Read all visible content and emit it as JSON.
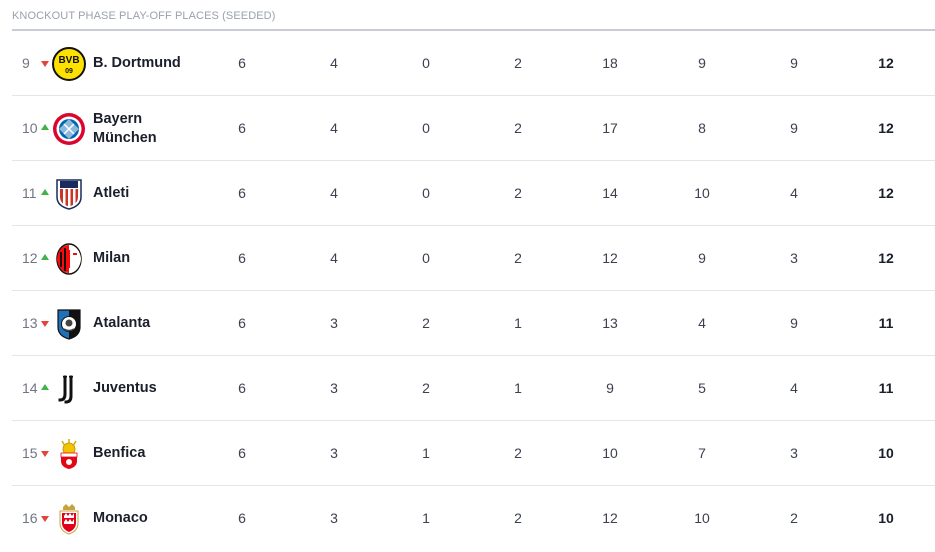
{
  "section": {
    "title": "KNOCKOUT PHASE PLAY-OFF PLACES (SEEDED)"
  },
  "colors": {
    "trend_up": "#3fb24a",
    "trend_down": "#e2443c",
    "divider": "#e3e5ea"
  },
  "rows": [
    {
      "position": "9",
      "trend": "down",
      "logo_icon": "dortmund-crest-icon",
      "team": "B. Dortmund",
      "played": "6",
      "won": "4",
      "drawn": "0",
      "lost": "2",
      "gf": "18",
      "ga": "9",
      "gd": "9",
      "points": "12"
    },
    {
      "position": "10",
      "trend": "up",
      "logo_icon": "bayern-crest-icon",
      "team": "Bayern München",
      "played": "6",
      "won": "4",
      "drawn": "0",
      "lost": "2",
      "gf": "17",
      "ga": "8",
      "gd": "9",
      "points": "12"
    },
    {
      "position": "11",
      "trend": "up",
      "logo_icon": "atleti-crest-icon",
      "team": "Atleti",
      "played": "6",
      "won": "4",
      "drawn": "0",
      "lost": "2",
      "gf": "14",
      "ga": "10",
      "gd": "4",
      "points": "12"
    },
    {
      "position": "12",
      "trend": "up",
      "logo_icon": "milan-crest-icon",
      "team": "Milan",
      "played": "6",
      "won": "4",
      "drawn": "0",
      "lost": "2",
      "gf": "12",
      "ga": "9",
      "gd": "3",
      "points": "12"
    },
    {
      "position": "13",
      "trend": "down",
      "logo_icon": "atalanta-crest-icon",
      "team": "Atalanta",
      "played": "6",
      "won": "3",
      "drawn": "2",
      "lost": "1",
      "gf": "13",
      "ga": "4",
      "gd": "9",
      "points": "11"
    },
    {
      "position": "14",
      "trend": "up",
      "logo_icon": "juventus-crest-icon",
      "team": "Juventus",
      "played": "6",
      "won": "3",
      "drawn": "2",
      "lost": "1",
      "gf": "9",
      "ga": "5",
      "gd": "4",
      "points": "11"
    },
    {
      "position": "15",
      "trend": "down",
      "logo_icon": "benfica-crest-icon",
      "team": "Benfica",
      "played": "6",
      "won": "3",
      "drawn": "1",
      "lost": "2",
      "gf": "10",
      "ga": "7",
      "gd": "3",
      "points": "10"
    },
    {
      "position": "16",
      "trend": "down",
      "logo_icon": "monaco-crest-icon",
      "team": "Monaco",
      "played": "6",
      "won": "3",
      "drawn": "1",
      "lost": "2",
      "gf": "12",
      "ga": "10",
      "gd": "2",
      "points": "10"
    }
  ]
}
